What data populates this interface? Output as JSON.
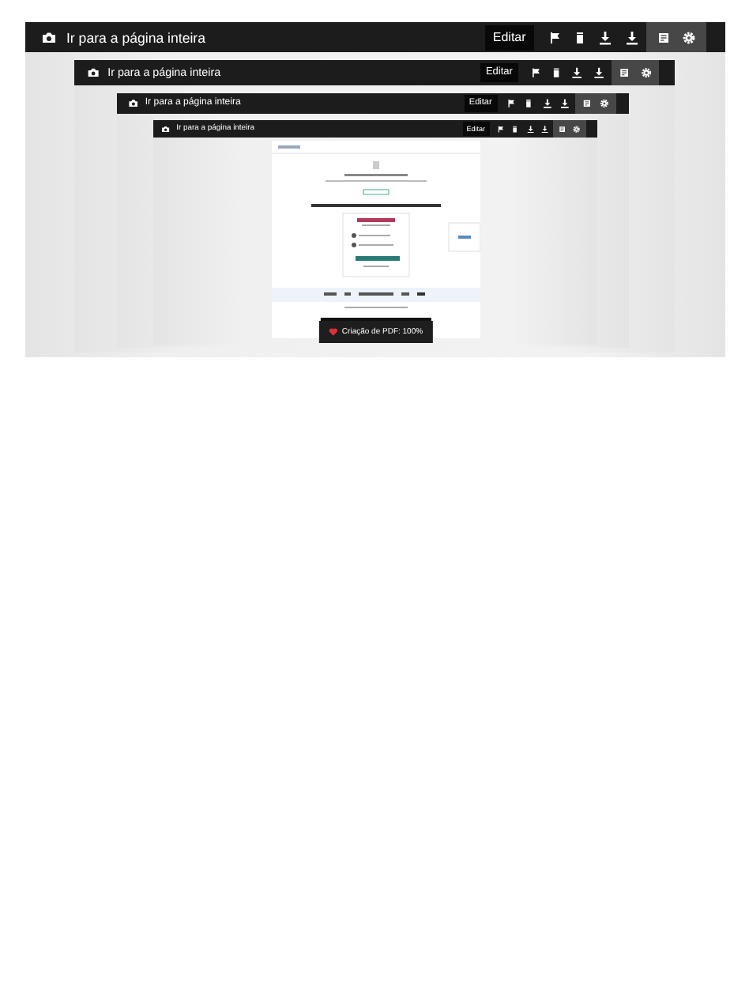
{
  "frames": [
    {
      "title": "Ir para a página inteira",
      "edit_button": "Editar"
    },
    {
      "title": "Ir para a página inteira",
      "edit_button": "Editar"
    },
    {
      "title": "Ir para a página inteira",
      "edit_button": "Editar"
    },
    {
      "title": "Ir para a página inteira",
      "edit_button": "Editar"
    }
  ],
  "toast": {
    "text": "Criação de PDF: 100%"
  }
}
